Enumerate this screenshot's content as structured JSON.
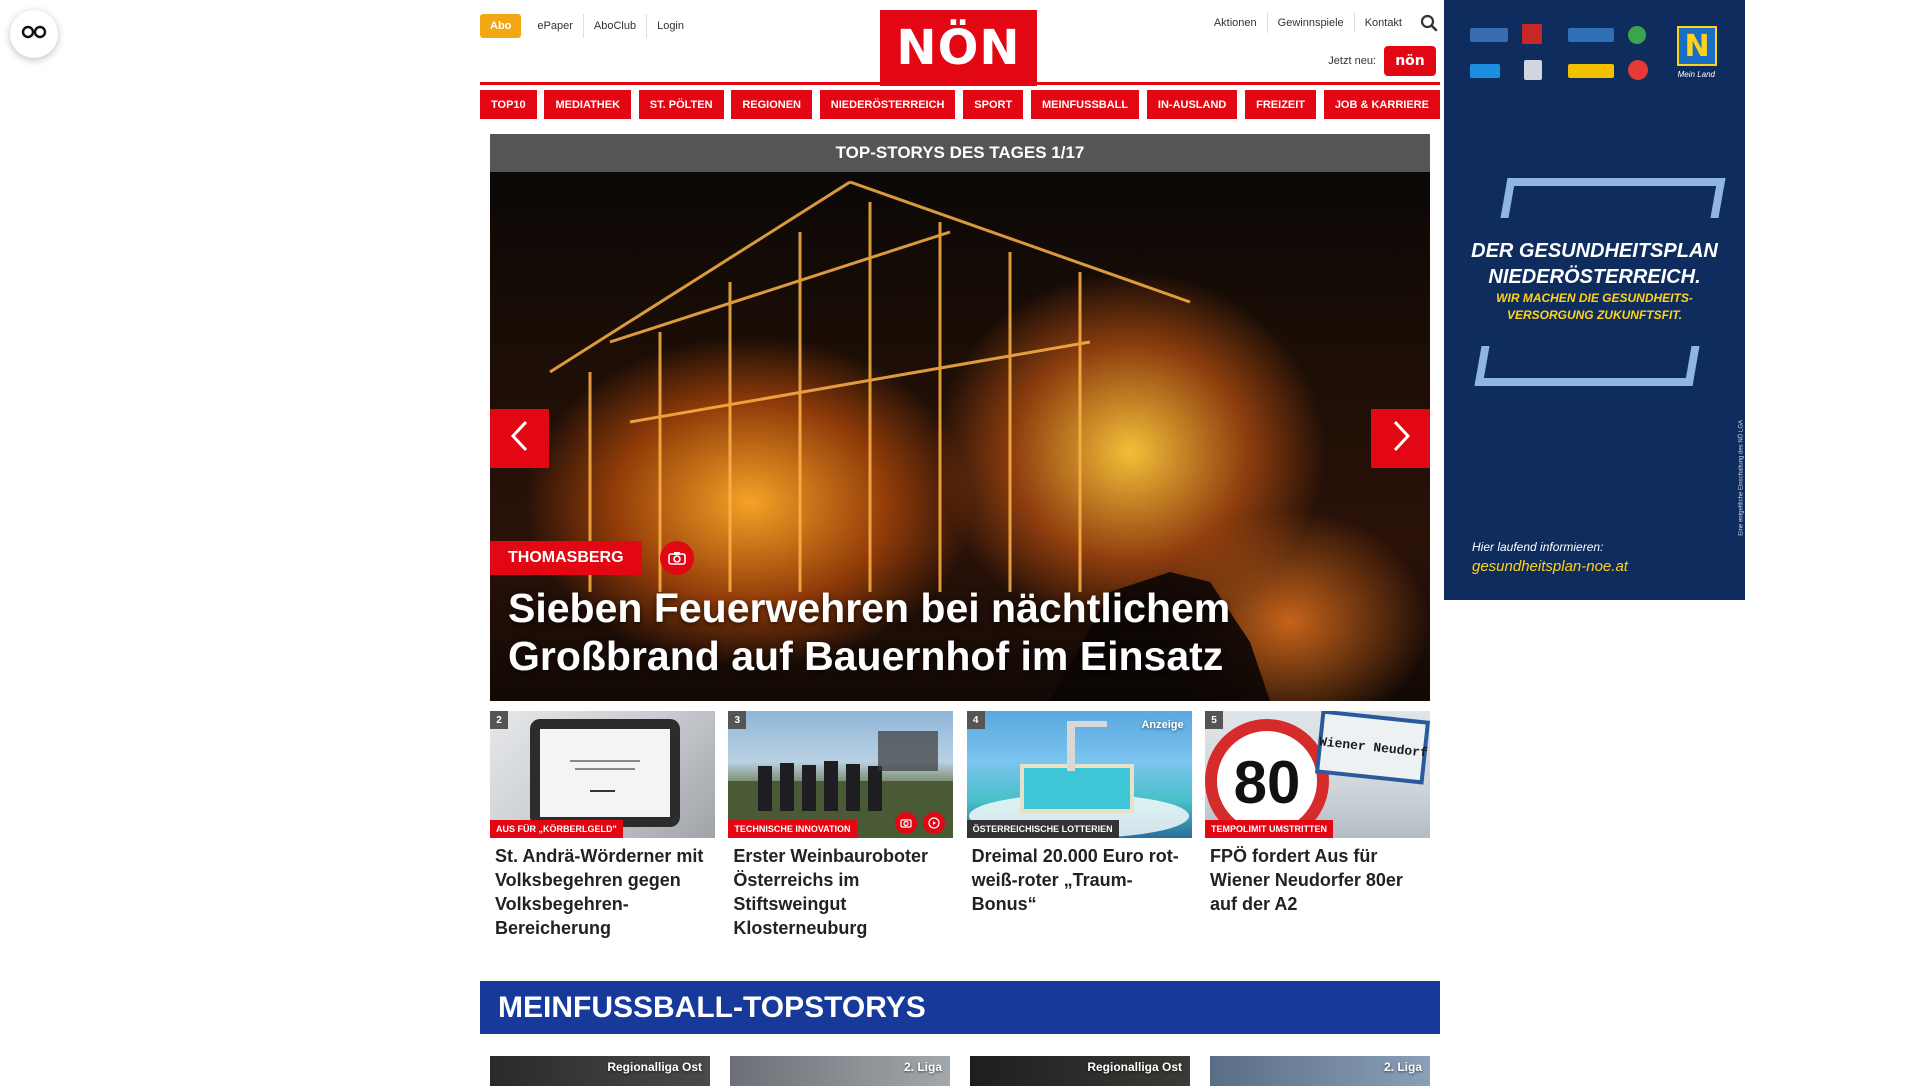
{
  "header": {
    "abo_label": "Abo",
    "top_links": [
      "ePaper",
      "AboClub",
      "Login"
    ],
    "logo_text": "NÖN",
    "right_links": [
      "Aktionen",
      "Gewinnspiele",
      "Kontakt"
    ],
    "jetzt_neu_label": "Jetzt neu:",
    "mini_logo_text": "nön"
  },
  "nav": {
    "items": [
      "TOP10",
      "MEDIATHEK",
      "ST. PÖLTEN",
      "REGIONEN",
      "NIEDERÖSTERREICH",
      "SPORT",
      "MEINFUSSBALL",
      "IN-AUSLAND",
      "FREIZEIT",
      "JOB & KARRIERE"
    ]
  },
  "hero": {
    "bar_title": "TOP-STORYS DES TAGES 1/17",
    "tag": "THOMASBERG",
    "headline": "Sieben Feuerwehren bei nächtlichem Großbrand auf Bauernhof im Einsatz"
  },
  "cards": [
    {
      "num": "2",
      "tag": "AUS FÜR „KÖRBERLGELD\"",
      "headline": "St. Andrä-Wörderner mit Volksbegehren gegen Volksbegehren-Bereicherung"
    },
    {
      "num": "3",
      "tag": "TECHNISCHE INNOVATION",
      "headline": "Erster Weinbauroboter Österreichs im Stiftsweingut Klosterneuburg"
    },
    {
      "num": "4",
      "tag": "ÖSTERREICHISCHE LOTTERIEN",
      "anzeige": "Anzeige",
      "headline": "Dreimal 20.000 Euro rot-weiß-roter „Traum-Bonus“"
    },
    {
      "num": "5",
      "tag": "TEMPOLIMIT UMSTRITTEN",
      "headline": "FPÖ fordert Aus für Wiener Neudorfer 80er auf der A2"
    }
  ],
  "meinfussball": {
    "title": "MEINFUSSBALL-TOPSTORYS",
    "cards": [
      {
        "league": "Regionalliga Ost"
      },
      {
        "league": "2. Liga"
      },
      {
        "league": "Regionalliga Ost"
      },
      {
        "league": "2. Liga"
      }
    ]
  },
  "ad": {
    "headline_line1": "DER GESUNDHEITSPLAN",
    "headline_line2": "NIEDERÖSTERREICH.",
    "sub_line1": "WIR MACHEN DIE GESUNDHEITS-",
    "sub_line2": "VERSORGUNG ZUKUNFTSFIT.",
    "info": "Hier laufend informieren:",
    "url": "gesundheitsplan-noe.at",
    "mein_land": "Mein Land",
    "vertical_note": "Eine entgeltliche Einschaltung des NÖ LGA",
    "brand_color": "#0e2d5e",
    "accent_color": "#ffd21a"
  },
  "colors": {
    "brand_red": "#e30613",
    "abo_orange": "#f3a712",
    "fussball_blue": "#16399a"
  },
  "icons": {
    "a11y": "glasses-icon",
    "search": "search-icon",
    "arrow_left": "chevron-left-icon",
    "arrow_right": "chevron-right-icon",
    "camera": "camera-icon",
    "play": "play-icon"
  }
}
